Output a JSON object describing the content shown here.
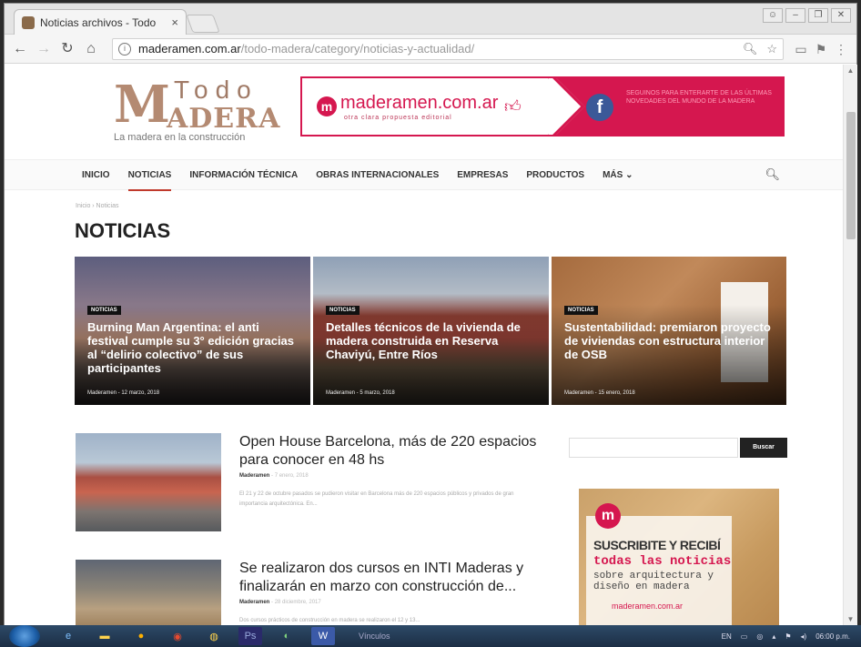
{
  "browser": {
    "tab_title": "Noticias archivos - Todo",
    "tab_close": "×",
    "url_host": "maderamen.com.ar",
    "url_path": "/todo-madera/category/noticias-y-actualidad/"
  },
  "header": {
    "logo_m": "M",
    "logo_todo": "Todo",
    "logo_adera": "ADERA",
    "logo_tagline": "La madera en la construcción",
    "banner_brand": "maderamen.com.ar",
    "banner_sub": "otra clara propuesta editorial",
    "banner_text": "Seguinos para enterarte de las últimas novedades del mundo de la madera"
  },
  "nav": {
    "items": [
      "INICIO",
      "NOTICIAS",
      "INFORMACIÓN TÉCNICA",
      "OBRAS INTERNACIONALES",
      "EMPRESAS",
      "PRODUCTOS",
      "MÁS ⌄"
    ]
  },
  "breadcrumb": "Inicio › Noticias",
  "page_title": "NOTICIAS",
  "heroes": [
    {
      "category": "NOTICIAS",
      "title": "Burning Man Argentina: el anti festival cumple su 3° edición gracias al “delirio colectivo” de sus participantes",
      "meta": "Maderamen - 12 marzo, 2018"
    },
    {
      "category": "NOTICIAS",
      "title": "Detalles técnicos de la vivienda de madera construida en Reserva Chaviyú, Entre Ríos",
      "meta": "Maderamen - 5 marzo, 2018"
    },
    {
      "category": "NOTICIAS",
      "title": "Sustentabilidad: premiaron proyecto de viviendas con estructura interior de OSB",
      "meta": "Maderamen - 15 enero, 2018"
    }
  ],
  "articles": [
    {
      "title": "Open House Barcelona, más de 220 espacios para conocer en 48 hs",
      "author": "Maderamen",
      "date": "- 7 enero, 2018",
      "excerpt": "El 21 y 22 de octubre pasados se pudieron visitar en Barcelona más de 220 espacios públicos y privados de gran importancia arquitectónica. En..."
    },
    {
      "title": "Se realizaron dos cursos en INTI Maderas y finalizarán en marzo con construcción de...",
      "author": "Maderamen",
      "date": "- 28 diciembre, 2017",
      "excerpt": "Dos cursos prácticos de construcción en madera se realizaron el 12 y 13..."
    }
  ],
  "sidebar": {
    "search_button": "Buscar",
    "ad_line1": "SUSCRIBITE Y RECIBÍ",
    "ad_line2": "todas las noticias",
    "ad_line3": "sobre arquitectura y diseño en madera",
    "ad_url": "maderamen.com.ar"
  },
  "taskbar": {
    "label": "Vínculos",
    "lang": "EN",
    "time": "06:00 p.m."
  }
}
